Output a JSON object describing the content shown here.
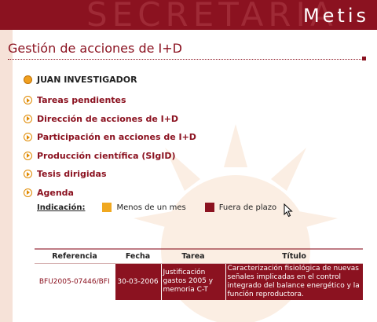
{
  "header": {
    "watermark": "SECRETARIA",
    "brand": "Metis"
  },
  "page": {
    "title": "Gestión de acciones de I+D"
  },
  "user": {
    "name": "JUAN INVESTIGADOR"
  },
  "menu": {
    "items": [
      {
        "label": "Tareas pendientes"
      },
      {
        "label": "Dirección de acciones de I+D"
      },
      {
        "label": "Participación en acciones de I+D"
      },
      {
        "label": "Producción científica (SIgID)"
      },
      {
        "label": "Tesis dirigidas"
      },
      {
        "label": "Agenda"
      }
    ]
  },
  "legend": {
    "label": "Indicación:",
    "items": [
      {
        "text": "Menos de un mes",
        "color": "#f0a820"
      },
      {
        "text": "Fuera de plazo",
        "color": "#8b1220"
      }
    ]
  },
  "table": {
    "headers": [
      "Referencia",
      "Fecha",
      "Tarea",
      "Título"
    ],
    "rows": [
      {
        "referencia": "BFU2005-07446/BFI",
        "fecha": "30-03-2006",
        "tarea": "Justificación gastos 2005 y memoria C-T",
        "titulo": "Caracterización fisiológica de nuevas señales implicadas en el control integrado del balance energético y la función reproductora."
      }
    ]
  },
  "colors": {
    "brand": "#8b1220",
    "accent": "#f0a820"
  }
}
